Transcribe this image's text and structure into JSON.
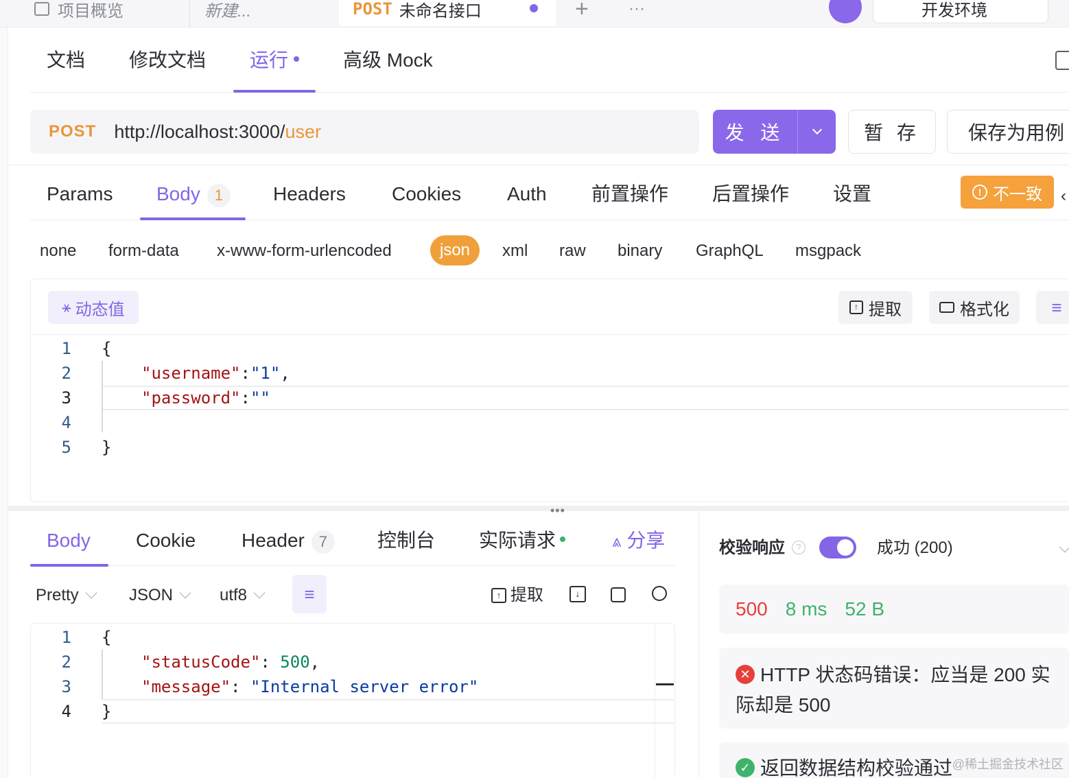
{
  "top_tabs": {
    "overview": "项目概览",
    "new": "新建...",
    "active_method": "POST",
    "active_title": "未命名接口",
    "add": "+",
    "more": "···",
    "env": "开发环境"
  },
  "doc_tabs": [
    "文档",
    "修改文档",
    "运行",
    "高级 Mock"
  ],
  "request": {
    "method": "POST",
    "url_base": "http://localhost:3000/",
    "url_path": "user",
    "send": "发 送",
    "save_temp": "暂 存",
    "save_case": "保存为用例"
  },
  "req_tabs": {
    "params": "Params",
    "body": "Body",
    "body_count": "1",
    "headers": "Headers",
    "cookies": "Cookies",
    "auth": "Auth",
    "pre": "前置操作",
    "post": "后置操作",
    "settings": "设置",
    "mismatch": "不一致"
  },
  "body_types": [
    "none",
    "form-data",
    "x-www-form-urlencoded",
    "json",
    "xml",
    "raw",
    "binary",
    "GraphQL",
    "msgpack"
  ],
  "editor": {
    "dynamic": "动态值",
    "extract": "提取",
    "format": "格式化",
    "lines": [
      "1",
      "2",
      "3",
      "4",
      "5"
    ],
    "l1": "{",
    "l2_key": "\"username\"",
    "l2_val": "\"1\"",
    "l3_key": "\"password\"",
    "l3_val": "\"\"",
    "l5": "}"
  },
  "response": {
    "tabs": {
      "body": "Body",
      "cookie": "Cookie",
      "header": "Header",
      "header_count": "7",
      "console": "控制台",
      "actual": "实际请求",
      "share": "分享"
    },
    "pretty": "Pretty",
    "json": "JSON",
    "encoding": "utf8",
    "extract": "提取",
    "lines": [
      "1",
      "2",
      "3",
      "4"
    ],
    "l1": "{",
    "l2_key": "\"statusCode\"",
    "l2_val": "500",
    "l3_key": "\"message\"",
    "l3_val": "\"Internal server error\"",
    "l4": "}"
  },
  "validate": {
    "label": "校验响应",
    "status": "成功 (200)",
    "code": "500",
    "time": "8 ms",
    "size": "52 B",
    "error": "HTTP 状态码错误：应当是 200 实际却是 500",
    "ok": "返回数据结构校验通过"
  },
  "watermark": "@稀土掘金技术社区",
  "colors": {
    "accent": "#8465e6",
    "orange": "#f0a03a",
    "error": "#e5403a",
    "success": "#3fb36b"
  }
}
